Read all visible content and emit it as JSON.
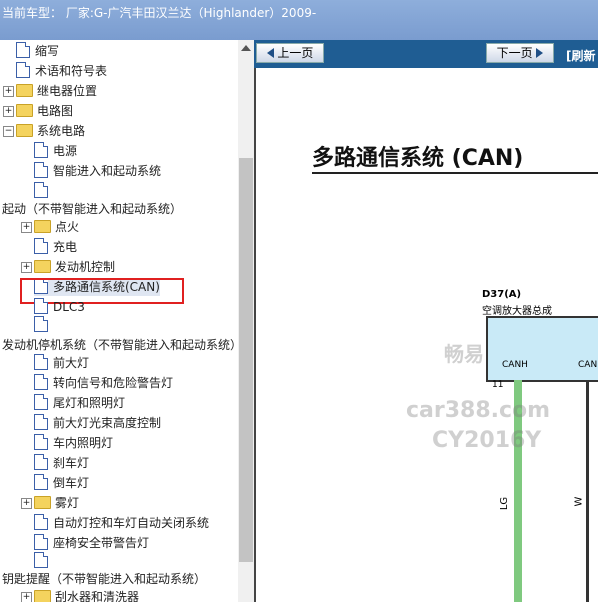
{
  "header": {
    "vehicle_line": "当前车型：  厂家:G-广汽丰田汉兰达（Highlander）2009-"
  },
  "tree": {
    "items": [
      {
        "label": "缩写"
      },
      {
        "label": "术语和符号表"
      },
      {
        "label": "继电器位置"
      },
      {
        "label": "电路图"
      },
      {
        "label": "系统电路"
      },
      {
        "label": "电源"
      },
      {
        "label": "智能进入和起动系统"
      },
      {
        "label": ""
      },
      {
        "label": "起动（不带智能进入和起动系统）"
      },
      {
        "label": "点火"
      },
      {
        "label": "充电"
      },
      {
        "label": "发动机控制"
      },
      {
        "label": "多路通信系统(CAN)"
      },
      {
        "label": "DLC3"
      },
      {
        "label": ""
      },
      {
        "label": "发动机停机系统（不带智能进入和起动系统）"
      },
      {
        "label": "前大灯"
      },
      {
        "label": "转向信号和危险警告灯"
      },
      {
        "label": "尾灯和照明灯"
      },
      {
        "label": "前大灯光束高度控制"
      },
      {
        "label": "车内照明灯"
      },
      {
        "label": "刹车灯"
      },
      {
        "label": "倒车灯"
      },
      {
        "label": "雾灯"
      },
      {
        "label": "自动灯控和车灯自动关闭系统"
      },
      {
        "label": "座椅安全带警告灯"
      },
      {
        "label": ""
      },
      {
        "label": "钥匙提醒（不带智能进入和起动系统）"
      },
      {
        "label": "刮水器和清洗器"
      }
    ]
  },
  "nav": {
    "prev_label": "上一页",
    "next_label": "下一页",
    "refresh_label": "[刷新"
  },
  "document": {
    "title": "多路通信系统 (CAN)",
    "connector_id": "D37(A)",
    "connector_name": "空调放大器总成",
    "can_left": "CANH",
    "can_right": "CAN",
    "pin": "11",
    "wire_left": "LG",
    "wire_right": "W"
  },
  "watermark": {
    "line1": "畅易",
    "line2": "car388.com",
    "line3": "CY2016Y"
  },
  "colors": {
    "nav_bar": "#1f5d93",
    "selection_box": "#e02020",
    "ecu_fill": "#c9eaf7",
    "wire_lg": "#7fc97f"
  }
}
